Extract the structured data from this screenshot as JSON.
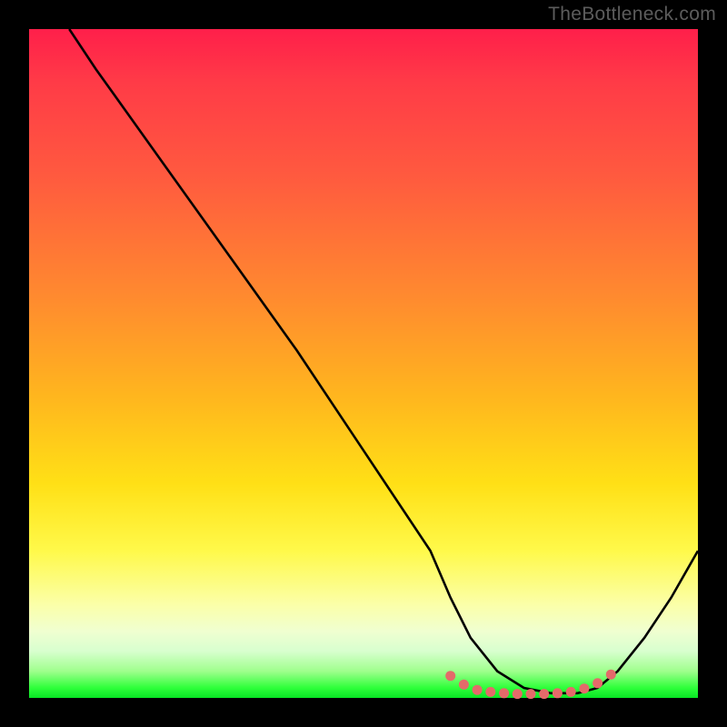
{
  "watermark": "TheBottleneck.com",
  "chart_data": {
    "type": "line",
    "title": "",
    "xlabel": "",
    "ylabel": "",
    "xlim": [
      0,
      100
    ],
    "ylim": [
      0,
      100
    ],
    "series": [
      {
        "name": "curve",
        "x": [
          6,
          10,
          20,
          30,
          40,
          50,
          60,
          63,
          66,
          70,
          74,
          78,
          82,
          85,
          88,
          92,
          96,
          100
        ],
        "y": [
          100,
          94,
          80,
          66,
          52,
          37,
          22,
          15,
          9,
          4,
          1.5,
          0.7,
          0.7,
          1.5,
          4,
          9,
          15,
          22
        ]
      }
    ],
    "markers": {
      "name": "highlight-dots",
      "color": "#e46a6a",
      "x": [
        63,
        65,
        67,
        69,
        71,
        73,
        75,
        77,
        79,
        81,
        83,
        85,
        87
      ],
      "y": [
        3.3,
        2.0,
        1.2,
        0.9,
        0.7,
        0.6,
        0.6,
        0.6,
        0.7,
        0.9,
        1.4,
        2.2,
        3.5
      ]
    },
    "gradient_stops": [
      {
        "pos": 0,
        "color": "#ff1f4a"
      },
      {
        "pos": 0.4,
        "color": "#ff8a2f"
      },
      {
        "pos": 0.68,
        "color": "#ffe016"
      },
      {
        "pos": 0.86,
        "color": "#fbffa8"
      },
      {
        "pos": 1.0,
        "color": "#08e524"
      }
    ]
  }
}
